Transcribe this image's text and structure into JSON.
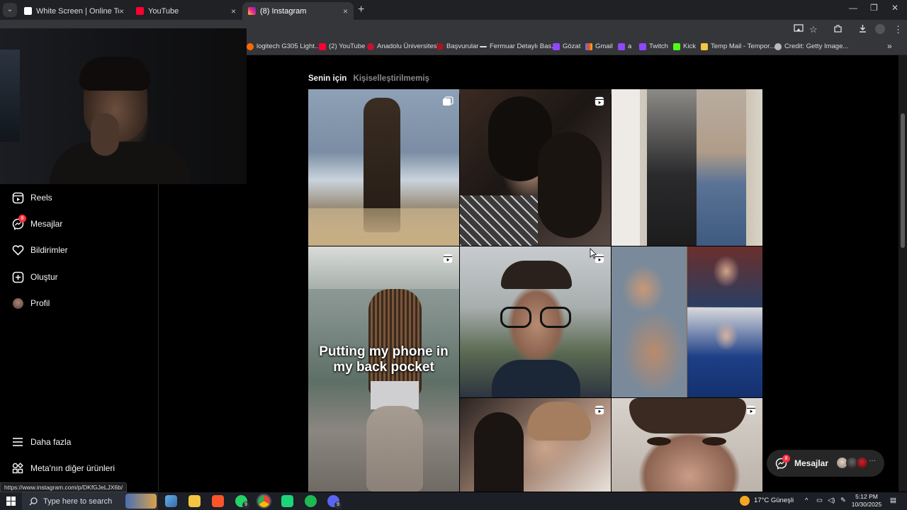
{
  "browser": {
    "tabs": [
      {
        "title": "White Screen | Online Tool",
        "color": "#ffffff"
      },
      {
        "title": "YouTube",
        "color": "#ff0033"
      },
      {
        "title": "(8) Instagram",
        "color": "#e1306c"
      }
    ],
    "tab_close": "×",
    "new_tab": "+",
    "window_controls": {
      "minimize": "—",
      "maximize": "❐",
      "close": "✕"
    },
    "bookmarks": [
      {
        "label": "logitech G305 Light...",
        "color": "#ff6a00"
      },
      {
        "label": "(2) YouTube",
        "color": "#ff0033"
      },
      {
        "label": "Anadolu Üniversitesi",
        "color": "#c8102e"
      },
      {
        "label": "Başvurular",
        "color": "#a31621"
      },
      {
        "label": "Fermuar Detaylı Bas...",
        "color": "#222222"
      },
      {
        "label": "Gözat",
        "color": "#9146ff"
      },
      {
        "label": "Gmail",
        "color": "#ea4335"
      },
      {
        "label": "a",
        "color": "#9146ff"
      },
      {
        "label": "Twitch",
        "color": "#9146ff"
      },
      {
        "label": "Kick",
        "color": "#53fc18"
      },
      {
        "label": "Temp Mail - Tempor...",
        "color": "#f5c542"
      },
      {
        "label": "Credit: Getty Image...",
        "color": "#bbbbbb"
      }
    ],
    "bookmarks_more": "»",
    "status_url": "https://www.instagram.com/p/DKfGJeLJX6b/"
  },
  "nav": {
    "items": [
      {
        "label": "Reels",
        "icon": "reels-icon"
      },
      {
        "label": "Mesajlar",
        "icon": "messenger-icon",
        "badge": "8"
      },
      {
        "label": "Bildirimler",
        "icon": "heart-icon"
      },
      {
        "label": "Oluştur",
        "icon": "plus-square-icon"
      },
      {
        "label": "Profil",
        "icon": "avatar"
      }
    ],
    "more": "Daha fazla",
    "meta": "Meta'nın diğer ürünleri"
  },
  "feed": {
    "tabs": [
      "Senin için",
      "Kişiselleştirilmemiş"
    ],
    "tiles": [
      {
        "type": "carousel",
        "icon": "carousel-icon"
      },
      {
        "type": "reel",
        "icon": "reels-icon"
      },
      {
        "type": "photo"
      },
      {
        "type": "reel",
        "icon": "reels-icon",
        "caption": "Putting my phone in my back pocket"
      },
      {
        "type": "reel",
        "icon": "reels-icon"
      },
      {
        "type": "photo"
      },
      {
        "type": "reel",
        "icon": "reels-icon"
      },
      {
        "type": "reel",
        "icon": "reels-icon"
      }
    ]
  },
  "messages_pill": {
    "label": "Mesajlar",
    "badge": "8",
    "more": "···"
  },
  "taskbar": {
    "search_placeholder": "Type here to search",
    "weather": "17°C  Güneşli",
    "time": "5:12 PM",
    "date": "10/30/2025",
    "whatsapp_badge": "9",
    "discord_badge": "9"
  },
  "colors": {
    "accent_badge": "#ff3040",
    "background": "#000000",
    "chrome": "#35363a"
  }
}
